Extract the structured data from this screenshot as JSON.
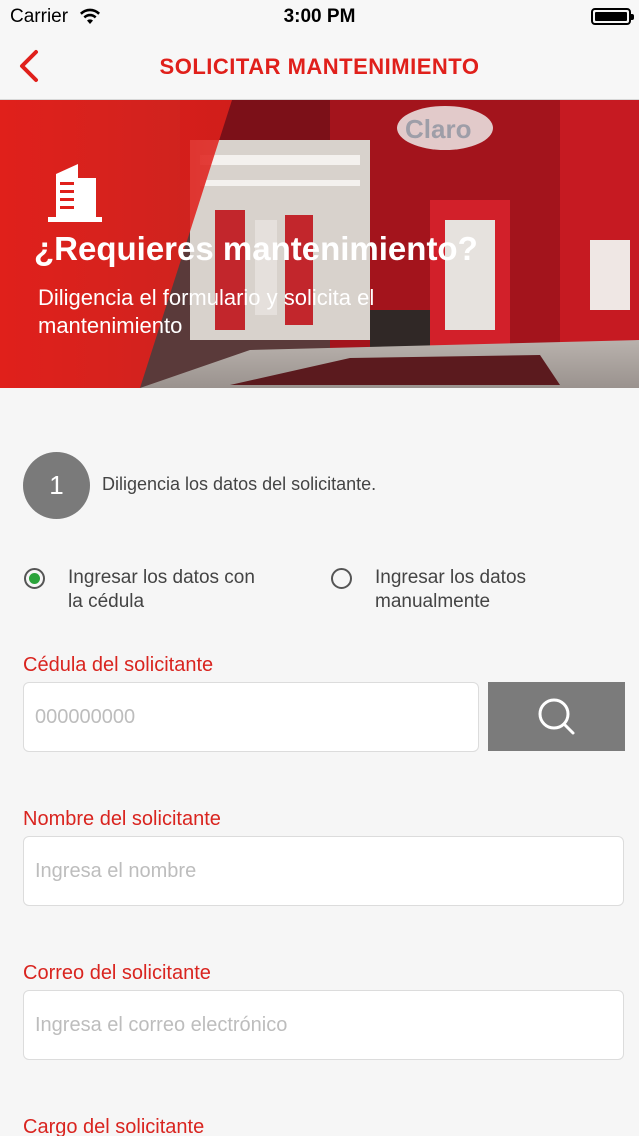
{
  "status_bar": {
    "carrier": "Carrier",
    "time": "3:00 PM"
  },
  "nav": {
    "title": "SOLICITAR MANTENIMIENTO",
    "back_icon": "chevron-left-icon"
  },
  "banner": {
    "title": "¿Requieres mantenimiento?",
    "subtitle": "Diligencia el formulario y solicita el mantenimiento",
    "icon": "building-icon"
  },
  "step": {
    "number": "1",
    "text": "Diligencia los datos del solicitante."
  },
  "radio_options": [
    {
      "label": "Ingresar los datos con la cédula",
      "checked": true
    },
    {
      "label": "Ingresar los datos manualmente",
      "checked": false
    }
  ],
  "fields": {
    "cedula": {
      "label": "Cédula del solicitante",
      "placeholder": "000000000"
    },
    "nombre": {
      "label": "Nombre del solicitante",
      "placeholder": "Ingresa el nombre"
    },
    "correo": {
      "label": "Correo del solicitante",
      "placeholder": "Ingresa el correo electrónico"
    },
    "cargo": {
      "label": "Cargo del solicitante"
    }
  },
  "colors": {
    "accent": "#e0201b",
    "radio_checked": "#2aa33a",
    "search_button": "#7b7b7b"
  }
}
